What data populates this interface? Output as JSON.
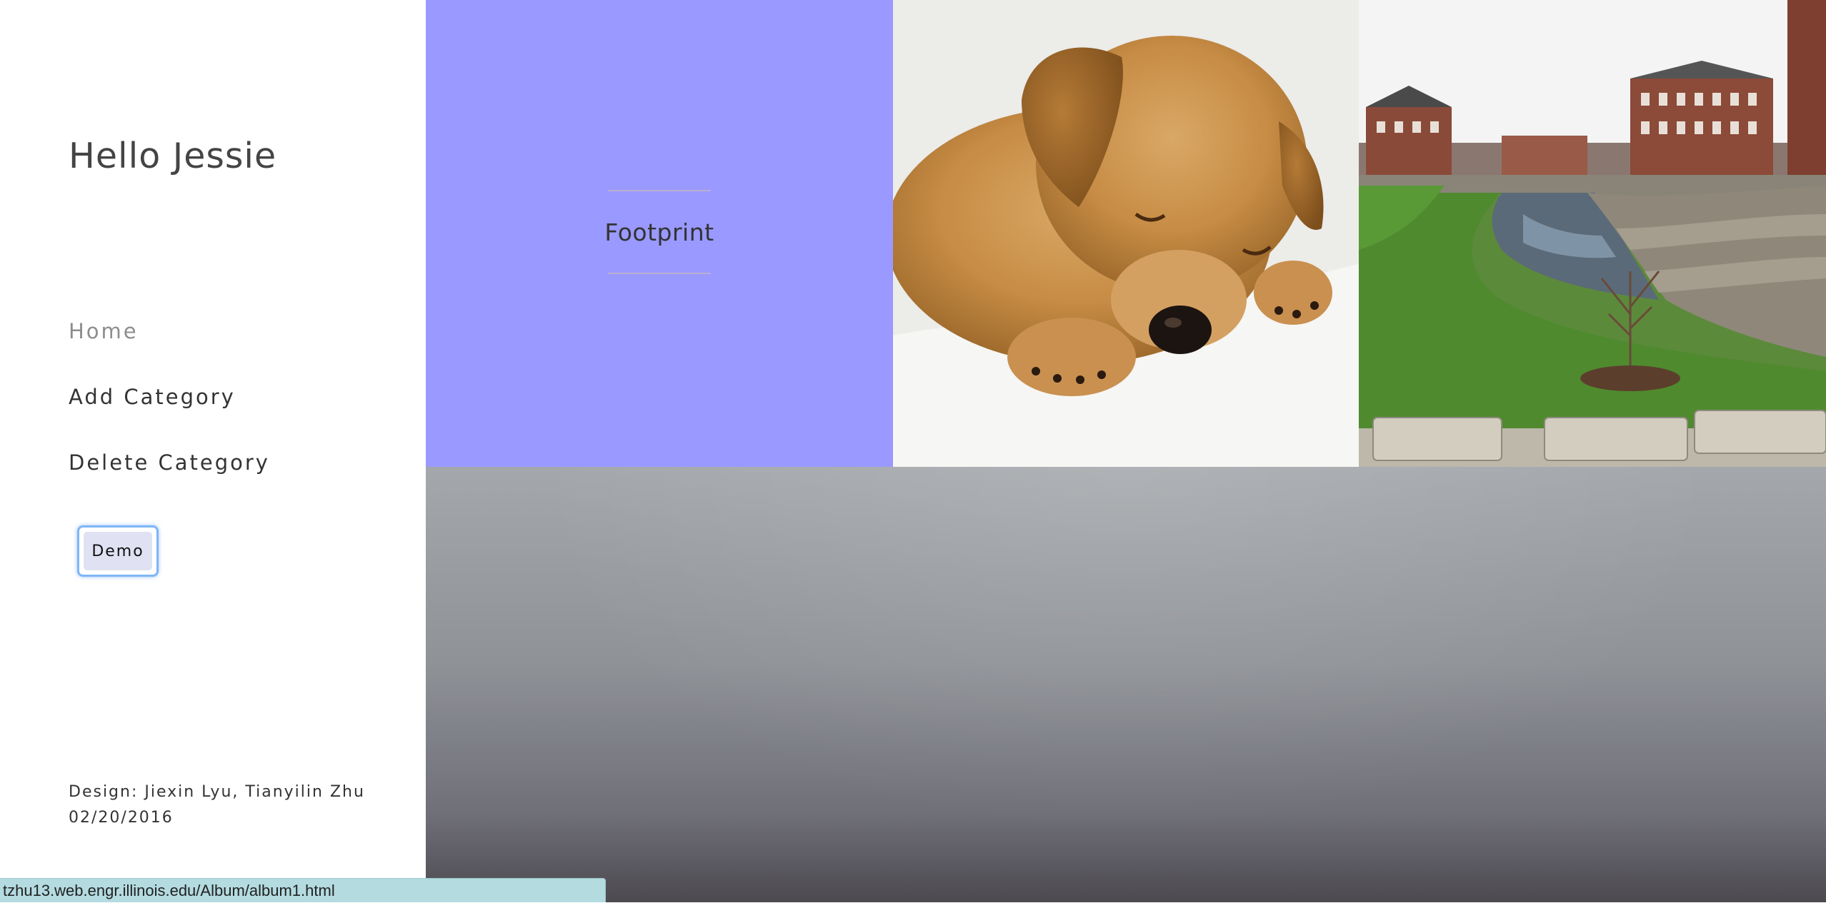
{
  "sidebar": {
    "greeting": "Hello Jessie",
    "nav": [
      {
        "label": "Home",
        "active": true
      },
      {
        "label": "Add Category",
        "active": false
      },
      {
        "label": "Delete Category",
        "active": false
      }
    ],
    "demo_button": "Demo",
    "credits": {
      "design": "Design: Jiexin Lyu, Tianyilin Zhu",
      "date": "02/20/2016"
    }
  },
  "gallery": {
    "title_tile": {
      "label": "Footprint",
      "color": "#9999ff"
    },
    "images": [
      {
        "name": "sleeping-puppy-image"
      },
      {
        "name": "campus-creek-image"
      }
    ]
  },
  "status_bar": {
    "url": "tzhu13.web.engr.illinois.edu/Album/album1.html"
  }
}
